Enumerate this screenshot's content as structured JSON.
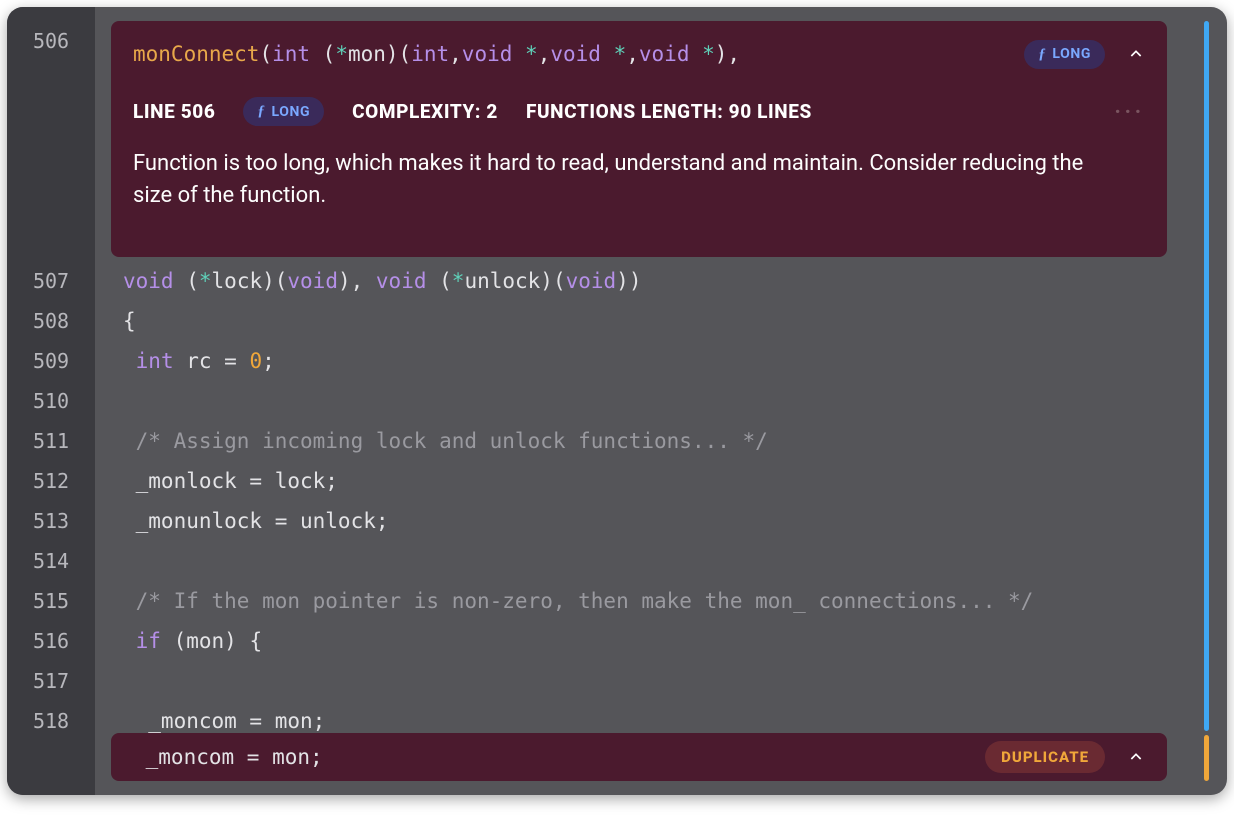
{
  "issue": {
    "signature_fn": "monConnect",
    "signature_rest_prefix": "(",
    "signature_kw1": "int",
    "signature_mid1": " (",
    "signature_op1": "*",
    "signature_mid2": "mon)(",
    "signature_kw2": "int",
    "signature_mid3": ",",
    "signature_kw3": "void",
    "signature_mid4": " ",
    "signature_op2": "*",
    "signature_mid5": ",",
    "signature_kw4": "void",
    "signature_mid6": " ",
    "signature_op3": "*",
    "signature_mid7": ",",
    "signature_kw5": "void",
    "signature_mid8": " ",
    "signature_op4": "*",
    "signature_mid9": "),",
    "badge_label": "LONG",
    "line_label": "LINE 506",
    "complexity_label": "COMPLEXITY: 2",
    "length_label": "FUNCTIONS LENGTH: 90 LINES",
    "description": "Function is too long, which makes it hard to read, understand and maintain. Consider reducing the size of the function."
  },
  "duplicate": {
    "code": " _moncom = mon;",
    "badge": "DUPLICATE"
  },
  "gutter": {
    "506": "506",
    "507": "507",
    "508": "508",
    "509": "509",
    "510": "510",
    "511": "511",
    "512": "512",
    "513": "513",
    "514": "514",
    "515": "515",
    "516": "516",
    "517": "517",
    "518": "518"
  },
  "code": {
    "l507_a": "void",
    "l507_b": " (",
    "l507_c": "*",
    "l507_d": "lock)(",
    "l507_e": "void",
    "l507_f": "), ",
    "l507_g": "void",
    "l507_h": " (",
    "l507_i": "*",
    "l507_j": "unlock)(",
    "l507_k": "void",
    "l507_l": "))",
    "l508": "{",
    "l509_a": " ",
    "l509_b": "int",
    "l509_c": " rc = ",
    "l509_d": "0",
    "l509_e": ";",
    "l511": " /* Assign incoming lock and unlock functions... */",
    "l512": " _monlock = lock;",
    "l513": " _monunlock = unlock;",
    "l515": " /* If the mon pointer is non-zero, then make the mon_ connections... */",
    "l516_a": " ",
    "l516_b": "if",
    "l516_c": " (mon) {",
    "l518": "  _moncom = mon;"
  }
}
